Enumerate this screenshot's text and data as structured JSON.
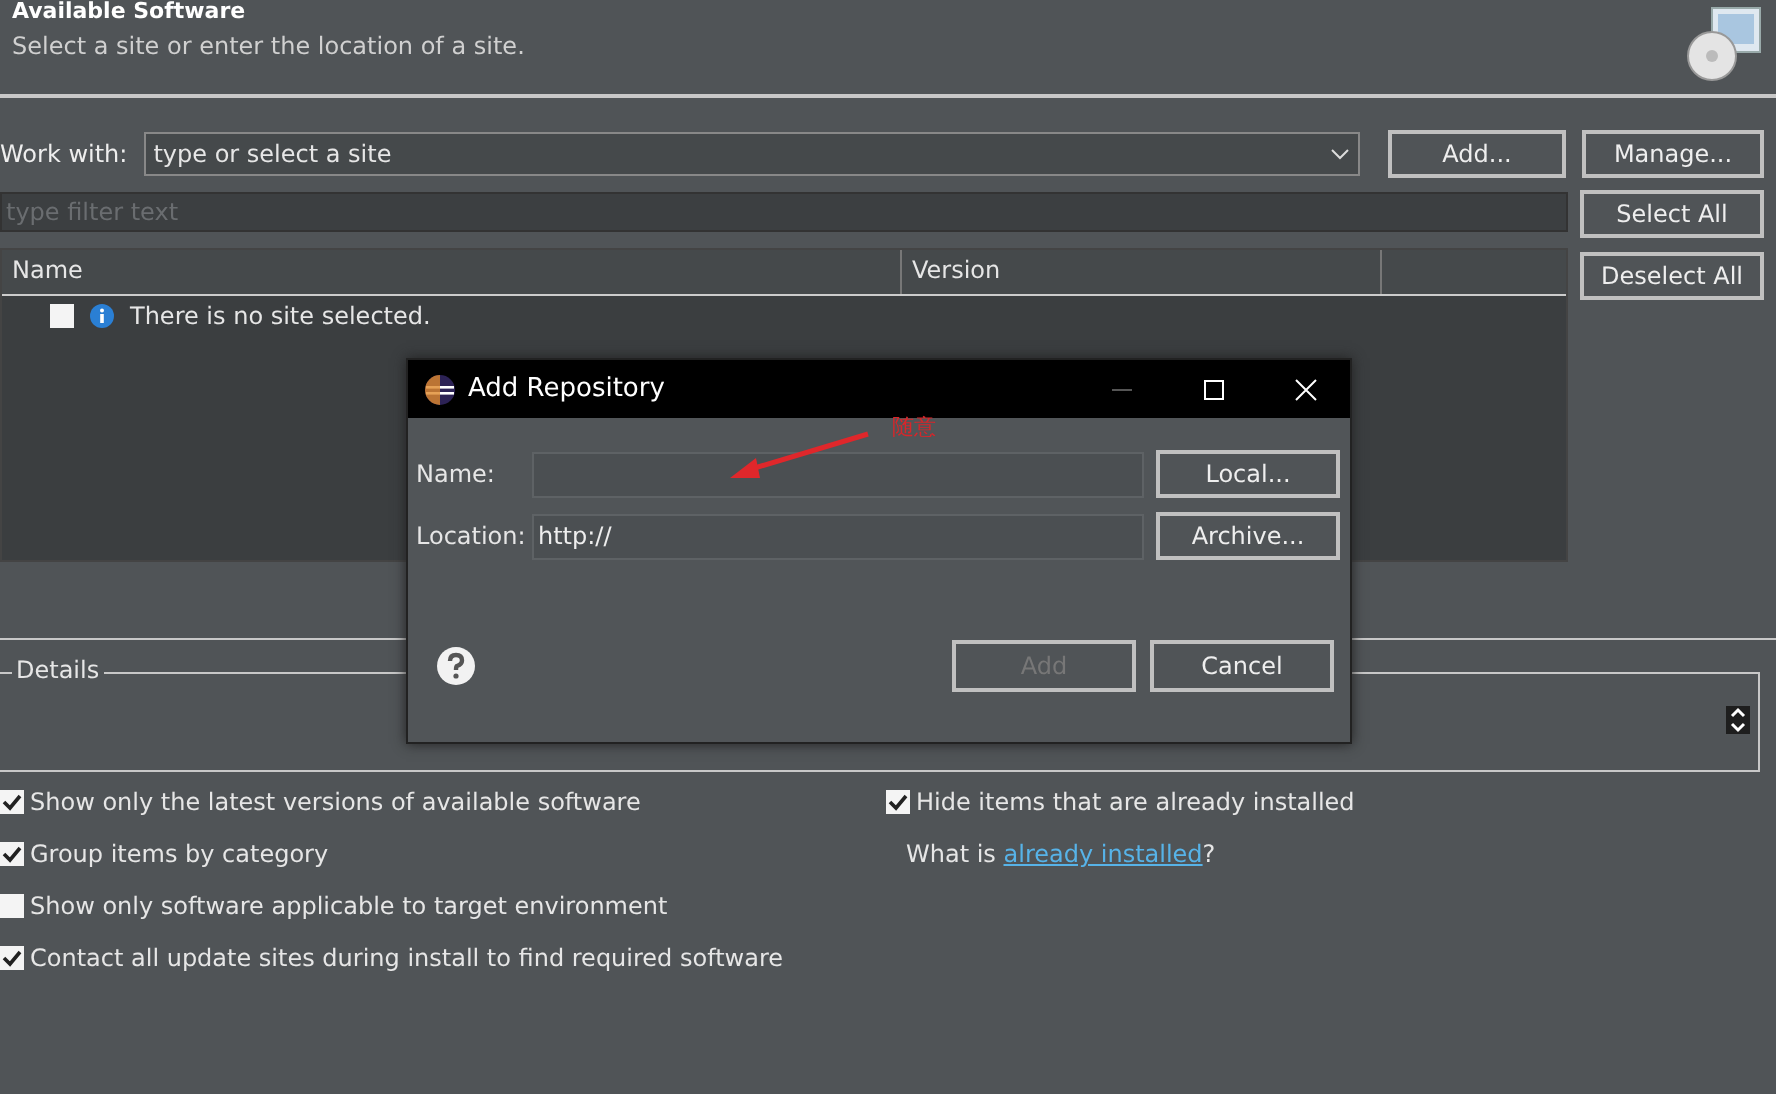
{
  "header": {
    "title": "Available Software",
    "description": "Select a site or enter the location of a site."
  },
  "work_with": {
    "label": "Work with:",
    "value": "type or select a site",
    "buttons": [
      "Add...",
      "Manage..."
    ]
  },
  "filter": {
    "placeholder": "type filter text"
  },
  "table": {
    "columns": [
      "Name",
      "Version"
    ],
    "rows": [
      {
        "checked": false,
        "text": "There is no site selected."
      }
    ]
  },
  "side_buttons": [
    "Select All",
    "Deselect All"
  ],
  "details": {
    "label": "Details"
  },
  "options": [
    {
      "label": "Show only the latest versions of available software",
      "checked": true
    },
    {
      "label": "Hide items that are already installed",
      "checked": true
    },
    {
      "label": "Group items by category",
      "checked": true
    },
    {
      "kind": "link",
      "prefix": "What is ",
      "link": "already installed",
      "suffix": "?"
    },
    {
      "label": "Show only software applicable to target environment",
      "checked": false
    },
    {
      "label": "Contact all update sites during install to find required software",
      "checked": true
    }
  ],
  "dialog": {
    "title": "Add Repository",
    "annotation": "随意",
    "fields": [
      {
        "label": "Name:",
        "button": "Local..."
      },
      {
        "label": "Location:",
        "value": "http://",
        "button": "Archive..."
      }
    ],
    "buttons": [
      {
        "label": "Add",
        "disabled": true
      },
      {
        "label": "Cancel",
        "disabled": false
      }
    ]
  }
}
